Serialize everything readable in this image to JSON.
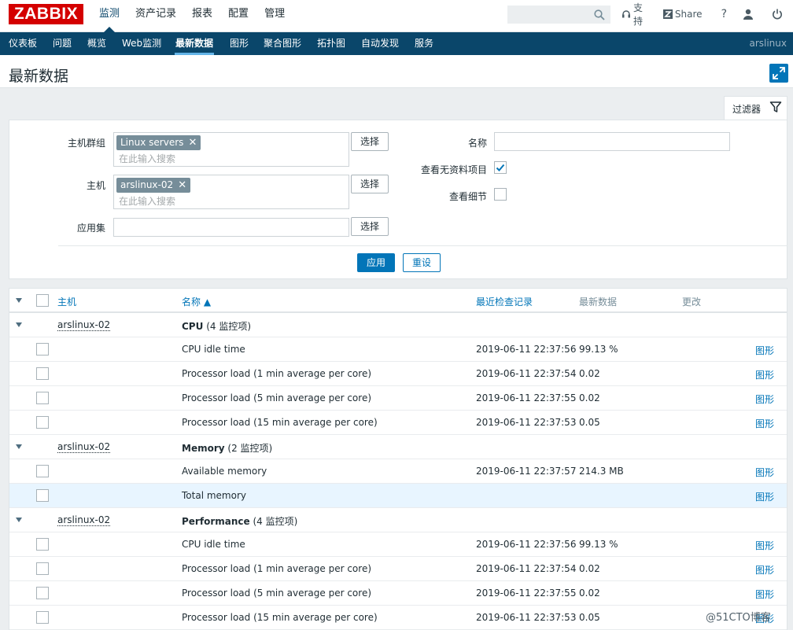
{
  "brand": {
    "logo_text": "ZABBIX",
    "accent": "#d40000",
    "nav_bg": "#0a466a",
    "link": "#0275b8"
  },
  "main_menu": [
    {
      "label": "监测",
      "active": true
    },
    {
      "label": "资产记录"
    },
    {
      "label": "报表"
    },
    {
      "label": "配置"
    },
    {
      "label": "管理"
    }
  ],
  "top_links": {
    "support": "支持",
    "share": "Share",
    "help": "?",
    "user_icon": "user-icon",
    "logout_icon": "power-icon"
  },
  "sub_menu": [
    {
      "label": "仪表板"
    },
    {
      "label": "问题"
    },
    {
      "label": "概览"
    },
    {
      "label": "Web监测"
    },
    {
      "label": "最新数据",
      "active": true
    },
    {
      "label": "图形"
    },
    {
      "label": "聚合图形"
    },
    {
      "label": "拓扑图"
    },
    {
      "label": "自动发现"
    },
    {
      "label": "服务"
    }
  ],
  "server_name": "arslinux",
  "page_title": "最新数据",
  "filter": {
    "tab_label": "过滤器",
    "host_group_label": "主机群组",
    "host_group_chip": "Linux servers",
    "host_group_placeholder": "在此输入搜索",
    "host_label": "主机",
    "host_chip": "arslinux-02",
    "host_placeholder": "在此输入搜索",
    "application_label": "应用集",
    "application_value": "",
    "select_label": "选择",
    "name_label": "名称",
    "name_value": "",
    "show_no_data_label": "查看无资料项目",
    "show_no_data_checked": true,
    "show_details_label": "查看细节",
    "show_details_checked": false,
    "apply_label": "应用",
    "reset_label": "重设"
  },
  "table": {
    "headers": {
      "host": "主机",
      "name": "名称 ▲",
      "last_check": "最近检查记录",
      "last_value": "最新数据",
      "change": "更改"
    },
    "graph_label": "图形",
    "groups": [
      {
        "host": "arslinux-02",
        "app": "CPU",
        "count": "(4 监控项)",
        "items": [
          {
            "name": "CPU idle time",
            "time": "2019-06-11 22:37:56",
            "value": "99.13 %"
          },
          {
            "name": "Processor load (1 min average per core)",
            "time": "2019-06-11 22:37:54",
            "value": "0.02"
          },
          {
            "name": "Processor load (5 min average per core)",
            "time": "2019-06-11 22:37:55",
            "value": "0.02"
          },
          {
            "name": "Processor load (15 min average per core)",
            "time": "2019-06-11 22:37:53",
            "value": "0.05"
          }
        ]
      },
      {
        "host": "arslinux-02",
        "app": "Memory",
        "count": "(2 监控项)",
        "items": [
          {
            "name": "Available memory",
            "time": "2019-06-11 22:37:57",
            "value": "214.3 MB"
          },
          {
            "name": "Total memory",
            "time": "",
            "value": "",
            "highlight": true
          }
        ]
      },
      {
        "host": "arslinux-02",
        "app": "Performance",
        "count": "(4 监控项)",
        "items": [
          {
            "name": "CPU idle time",
            "time": "2019-06-11 22:37:56",
            "value": "99.13 %"
          },
          {
            "name": "Processor load (1 min average per core)",
            "time": "2019-06-11 22:37:54",
            "value": "0.02"
          },
          {
            "name": "Processor load (5 min average per core)",
            "time": "2019-06-11 22:37:55",
            "value": "0.02"
          },
          {
            "name": "Processor load (15 min average per core)",
            "time": "2019-06-11 22:37:53",
            "value": "0.05"
          }
        ]
      }
    ]
  },
  "watermark": "@51CTO博客"
}
